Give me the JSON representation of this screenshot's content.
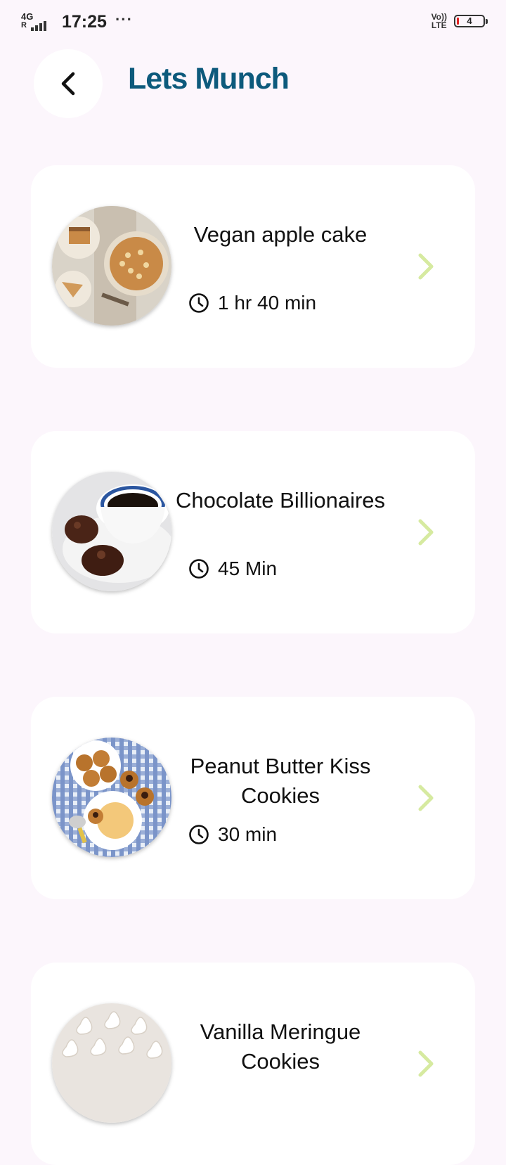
{
  "status_bar": {
    "network": "4G",
    "roaming": "R",
    "time": "17:25",
    "overflow": "···",
    "volte_top": "Vo))",
    "volte_bottom": "LTE",
    "battery": "4"
  },
  "header": {
    "title": "Lets Munch",
    "back_icon": "chevron-left-icon"
  },
  "colors": {
    "title": "#0d5a7c",
    "chevron": "#d6eaa0",
    "background": "#fcf6fc"
  },
  "recipes": [
    {
      "title": "Vegan apple cake",
      "time": "1 hr 40 min"
    },
    {
      "title": "Chocolate Billionaires",
      "time": "45 Min"
    },
    {
      "title": "Peanut Butter Kiss Cookies",
      "time": "30 min"
    },
    {
      "title": "Vanilla Meringue Cookies",
      "time": ""
    }
  ]
}
